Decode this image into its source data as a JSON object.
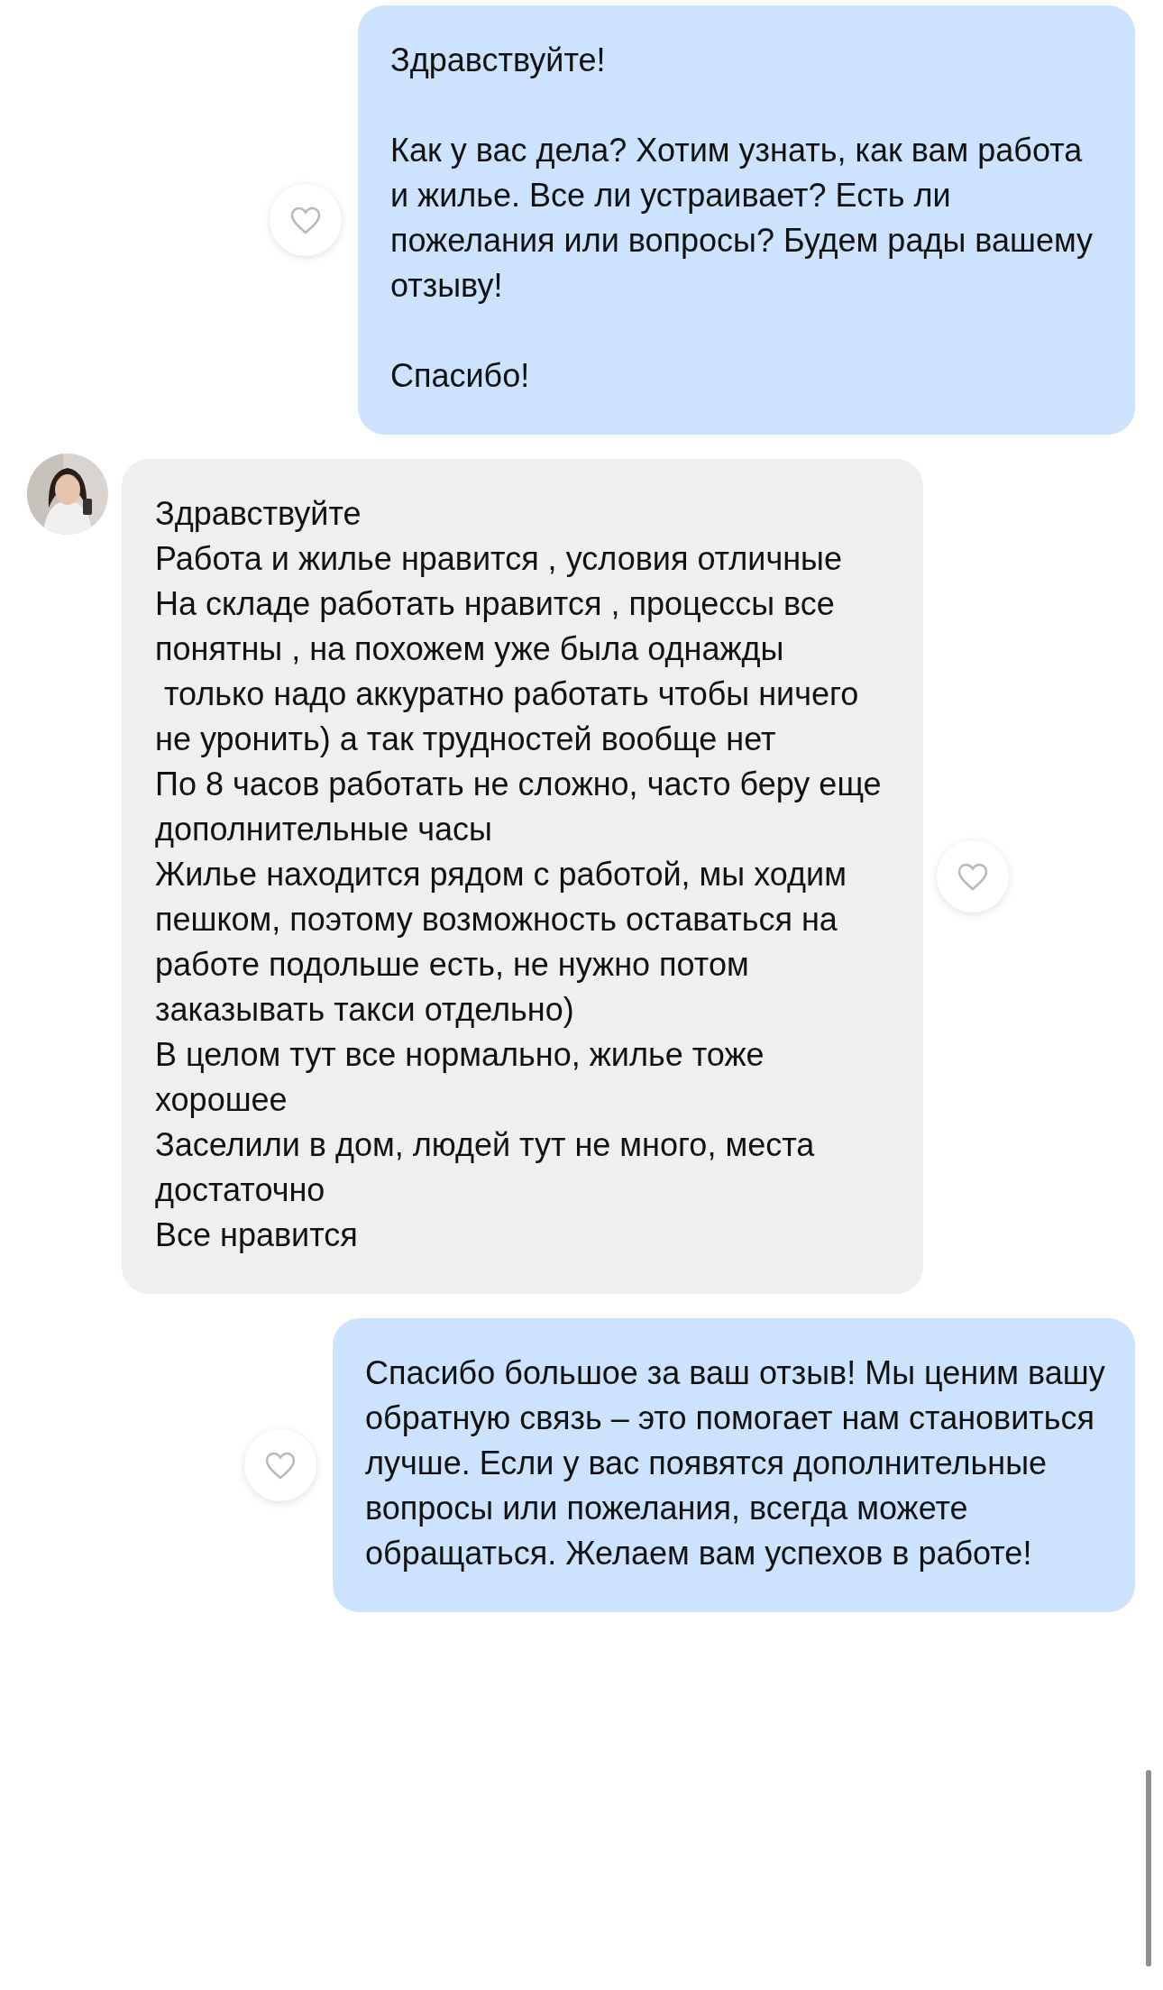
{
  "messages": [
    {
      "kind": "outgoing",
      "text": "Здравствуйте!\n\nКак у вас дела? Хотим узнать, как вам работа и жилье. Все ли устраивает? Есть ли пожелания или вопросы? Будем рады вашему отзыву!\n\nСпасибо!",
      "liked": false
    },
    {
      "kind": "incoming",
      "text": "Здравствуйте\nРабота и жилье нравится , условия отличные\nНа складе работать нравится , процессы все понятны , на похожем уже была однажды\n только надо аккуратно работать чтобы ничего не уронить) а так трудностей вообще нет\nПо 8 часов работать не сложно, часто беру еще дополнительные часы\nЖилье находится рядом с работой, мы ходим пешком, поэтому возможность оставаться на работе подольше есть, не нужно потом заказывать такси отдельно)\nВ целом тут все нормально, жилье тоже хорошее\nЗаселили в дом, людей тут не много, места достаточно\nВсе нравится",
      "liked": false
    },
    {
      "kind": "outgoing",
      "text": "Спасибо большое за ваш отзыв! Мы ценим вашу обратную связь – это помогает нам становиться лучше. Если у вас появятся дополнительные вопросы или пожелания, всегда можете обращаться. Желаем вам успехов в работе!",
      "liked": false
    }
  ]
}
